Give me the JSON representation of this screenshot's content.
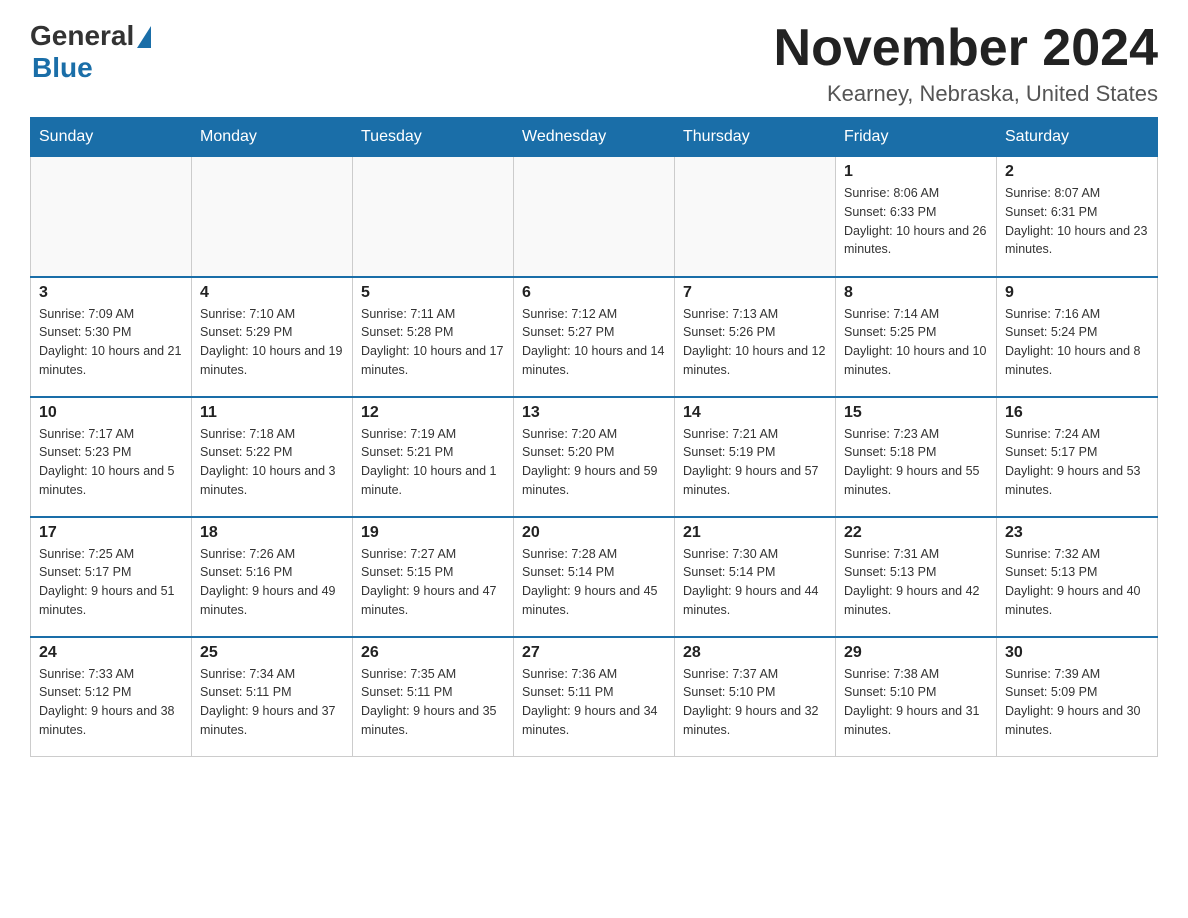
{
  "header": {
    "logo_general": "General",
    "logo_blue": "Blue",
    "title": "November 2024",
    "location": "Kearney, Nebraska, United States"
  },
  "days_of_week": [
    "Sunday",
    "Monday",
    "Tuesday",
    "Wednesday",
    "Thursday",
    "Friday",
    "Saturday"
  ],
  "weeks": [
    [
      {
        "day": "",
        "info": ""
      },
      {
        "day": "",
        "info": ""
      },
      {
        "day": "",
        "info": ""
      },
      {
        "day": "",
        "info": ""
      },
      {
        "day": "",
        "info": ""
      },
      {
        "day": "1",
        "info": "Sunrise: 8:06 AM\nSunset: 6:33 PM\nDaylight: 10 hours and 26 minutes."
      },
      {
        "day": "2",
        "info": "Sunrise: 8:07 AM\nSunset: 6:31 PM\nDaylight: 10 hours and 23 minutes."
      }
    ],
    [
      {
        "day": "3",
        "info": "Sunrise: 7:09 AM\nSunset: 5:30 PM\nDaylight: 10 hours and 21 minutes."
      },
      {
        "day": "4",
        "info": "Sunrise: 7:10 AM\nSunset: 5:29 PM\nDaylight: 10 hours and 19 minutes."
      },
      {
        "day": "5",
        "info": "Sunrise: 7:11 AM\nSunset: 5:28 PM\nDaylight: 10 hours and 17 minutes."
      },
      {
        "day": "6",
        "info": "Sunrise: 7:12 AM\nSunset: 5:27 PM\nDaylight: 10 hours and 14 minutes."
      },
      {
        "day": "7",
        "info": "Sunrise: 7:13 AM\nSunset: 5:26 PM\nDaylight: 10 hours and 12 minutes."
      },
      {
        "day": "8",
        "info": "Sunrise: 7:14 AM\nSunset: 5:25 PM\nDaylight: 10 hours and 10 minutes."
      },
      {
        "day": "9",
        "info": "Sunrise: 7:16 AM\nSunset: 5:24 PM\nDaylight: 10 hours and 8 minutes."
      }
    ],
    [
      {
        "day": "10",
        "info": "Sunrise: 7:17 AM\nSunset: 5:23 PM\nDaylight: 10 hours and 5 minutes."
      },
      {
        "day": "11",
        "info": "Sunrise: 7:18 AM\nSunset: 5:22 PM\nDaylight: 10 hours and 3 minutes."
      },
      {
        "day": "12",
        "info": "Sunrise: 7:19 AM\nSunset: 5:21 PM\nDaylight: 10 hours and 1 minute."
      },
      {
        "day": "13",
        "info": "Sunrise: 7:20 AM\nSunset: 5:20 PM\nDaylight: 9 hours and 59 minutes."
      },
      {
        "day": "14",
        "info": "Sunrise: 7:21 AM\nSunset: 5:19 PM\nDaylight: 9 hours and 57 minutes."
      },
      {
        "day": "15",
        "info": "Sunrise: 7:23 AM\nSunset: 5:18 PM\nDaylight: 9 hours and 55 minutes."
      },
      {
        "day": "16",
        "info": "Sunrise: 7:24 AM\nSunset: 5:17 PM\nDaylight: 9 hours and 53 minutes."
      }
    ],
    [
      {
        "day": "17",
        "info": "Sunrise: 7:25 AM\nSunset: 5:17 PM\nDaylight: 9 hours and 51 minutes."
      },
      {
        "day": "18",
        "info": "Sunrise: 7:26 AM\nSunset: 5:16 PM\nDaylight: 9 hours and 49 minutes."
      },
      {
        "day": "19",
        "info": "Sunrise: 7:27 AM\nSunset: 5:15 PM\nDaylight: 9 hours and 47 minutes."
      },
      {
        "day": "20",
        "info": "Sunrise: 7:28 AM\nSunset: 5:14 PM\nDaylight: 9 hours and 45 minutes."
      },
      {
        "day": "21",
        "info": "Sunrise: 7:30 AM\nSunset: 5:14 PM\nDaylight: 9 hours and 44 minutes."
      },
      {
        "day": "22",
        "info": "Sunrise: 7:31 AM\nSunset: 5:13 PM\nDaylight: 9 hours and 42 minutes."
      },
      {
        "day": "23",
        "info": "Sunrise: 7:32 AM\nSunset: 5:13 PM\nDaylight: 9 hours and 40 minutes."
      }
    ],
    [
      {
        "day": "24",
        "info": "Sunrise: 7:33 AM\nSunset: 5:12 PM\nDaylight: 9 hours and 38 minutes."
      },
      {
        "day": "25",
        "info": "Sunrise: 7:34 AM\nSunset: 5:11 PM\nDaylight: 9 hours and 37 minutes."
      },
      {
        "day": "26",
        "info": "Sunrise: 7:35 AM\nSunset: 5:11 PM\nDaylight: 9 hours and 35 minutes."
      },
      {
        "day": "27",
        "info": "Sunrise: 7:36 AM\nSunset: 5:11 PM\nDaylight: 9 hours and 34 minutes."
      },
      {
        "day": "28",
        "info": "Sunrise: 7:37 AM\nSunset: 5:10 PM\nDaylight: 9 hours and 32 minutes."
      },
      {
        "day": "29",
        "info": "Sunrise: 7:38 AM\nSunset: 5:10 PM\nDaylight: 9 hours and 31 minutes."
      },
      {
        "day": "30",
        "info": "Sunrise: 7:39 AM\nSunset: 5:09 PM\nDaylight: 9 hours and 30 minutes."
      }
    ]
  ]
}
